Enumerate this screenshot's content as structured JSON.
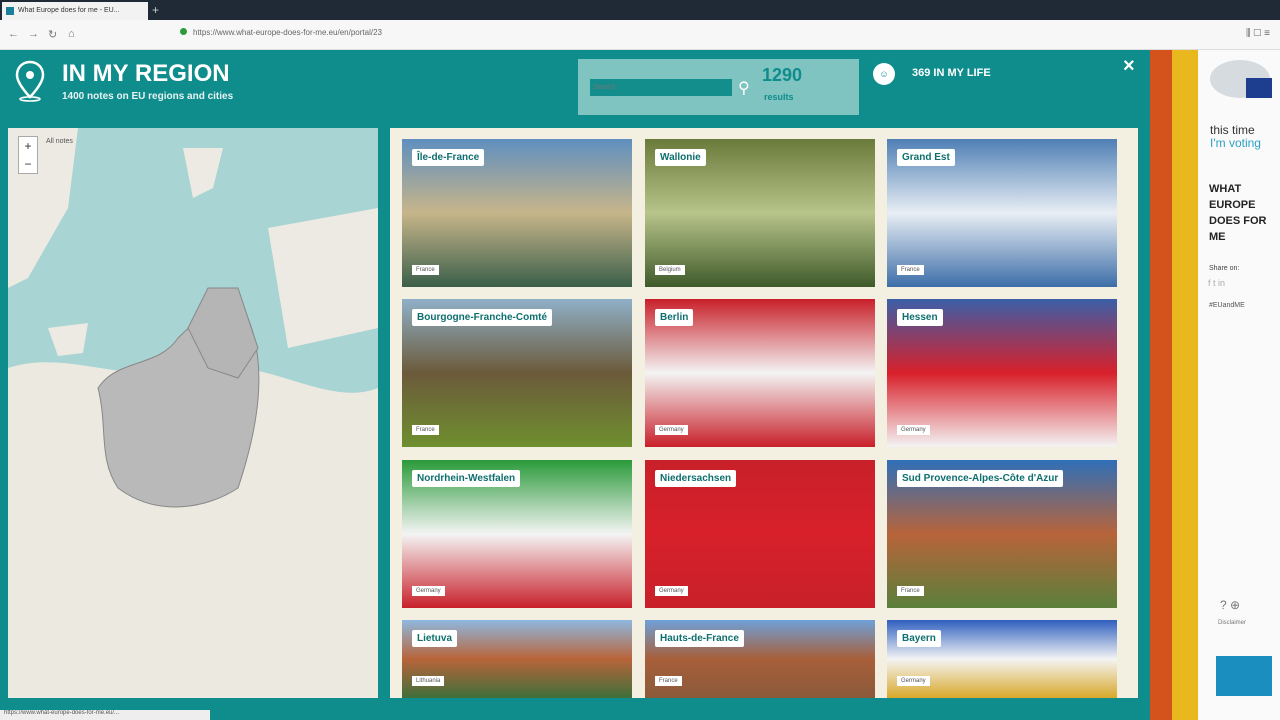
{
  "browser": {
    "tab_title": "What Europe does for me - EU...",
    "url": "https://www.what-europe-does-for-me.eu/en/portal/23"
  },
  "header": {
    "title": "IN MY REGION",
    "subtitle": "1400 notes on EU regions and cities",
    "search_placeholder": "Search",
    "results_count": "1290",
    "results_label": "results",
    "life_label": "369 IN MY LIFE",
    "life_icon": "face-icon",
    "close": "×"
  },
  "map": {
    "zoom_in": "+",
    "zoom_out": "−",
    "filter_label": "All notes"
  },
  "tiles": [
    {
      "name": "Île-de-France",
      "country": "France",
      "colors": [
        "#5f8fbf",
        "#c7b58a",
        "#3b5f4a"
      ]
    },
    {
      "name": "Wallonie",
      "country": "Belgium",
      "colors": [
        "#6a7a3a",
        "#b8c48a",
        "#3f5a2a"
      ]
    },
    {
      "name": "Grand Est",
      "country": "France",
      "colors": [
        "#4f7fb5",
        "#e8eef4",
        "#3d6ea8"
      ]
    },
    {
      "name": "Bourgogne-Franche-Comté",
      "country": "France",
      "colors": [
        "#8fb0c8",
        "#6b5a3a",
        "#6f8f2f"
      ]
    },
    {
      "name": "Berlin",
      "country": "Germany",
      "colors": [
        "#c8202a",
        "#f4f4f4",
        "#c8202a"
      ]
    },
    {
      "name": "Hessen",
      "country": "Germany",
      "colors": [
        "#3a5fa8",
        "#d8202a",
        "#f4f4f4"
      ]
    },
    {
      "name": "Nordrhein-Westfalen",
      "country": "Germany",
      "colors": [
        "#2a9a3a",
        "#f4f4f4",
        "#c8202a"
      ]
    },
    {
      "name": "Niedersachsen",
      "country": "Germany",
      "colors": [
        "#c8202a",
        "#d8202a",
        "#c8202a"
      ]
    },
    {
      "name": "Sud Provence-Alpes-Côte d'Azur",
      "country": "France",
      "colors": [
        "#2f6fb8",
        "#b8643a",
        "#5a7f3a"
      ]
    },
    {
      "name": "Lietuva",
      "country": "Lithuania",
      "colors": [
        "#8fb8e0",
        "#b8643a",
        "#3f6f3a"
      ]
    },
    {
      "name": "Hauts-de-France",
      "country": "France",
      "colors": [
        "#6fa0d8",
        "#a85f3a",
        "#8a5a3a"
      ]
    },
    {
      "name": "Bayern",
      "country": "Germany",
      "colors": [
        "#2f5fbf",
        "#f4f4f4",
        "#d8a82a"
      ]
    }
  ],
  "sidebar": {
    "line1": "this time",
    "line2": "I'm voting",
    "heading": "WHAT EUROPE DOES FOR ME",
    "share_label": "Share on:",
    "share_icons": "f t in",
    "hashtag": "#EUandME",
    "help_icons": "? ⊕",
    "help_label": "Disclaimer"
  },
  "statusbar": "https://www.what-europe-does-for-me.eu/..."
}
